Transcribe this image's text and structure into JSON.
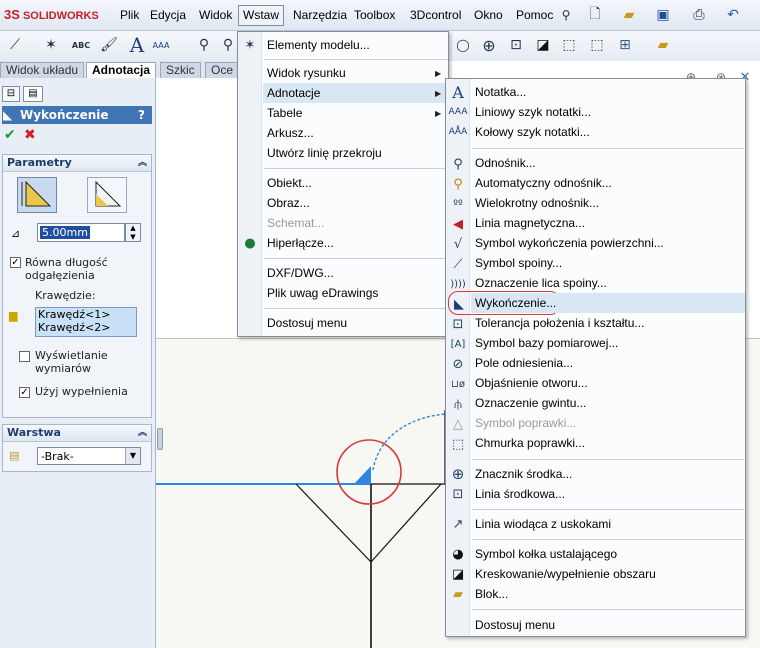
{
  "app": {
    "logo_symbol": "3S",
    "logo_text": "SOLIDWORKS"
  },
  "menubar": {
    "items": [
      "Plik",
      "Edycja",
      "Widok",
      "Wstaw",
      "Narzędzia",
      "Toolbox",
      "3Dcontrol",
      "Okno",
      "Pomoc"
    ]
  },
  "tabs": [
    "Widok układu",
    "Adnotacja",
    "Szkic",
    "Oce"
  ],
  "panel": {
    "title": "Wykończenie",
    "help": "?",
    "params_label": "Parametry",
    "value": "5.00mm",
    "equal_length_label": "Równa długość odgałęzienia",
    "edges_label": "Krawędzie:",
    "edges": [
      "Krawędź<1>",
      "Krawędź<2>"
    ],
    "show_dims_label": "Wyświetlanie wymiarów",
    "use_fill_label": "Użyj wypełnienia",
    "layer_label": "Warstwa",
    "layer_value": "-Brak-"
  },
  "wstaw_menu": {
    "items": [
      "Elementy modelu...",
      "Widok rysunku",
      "Adnotacje",
      "Tabele",
      "Arkusz...",
      "Utwórz linię przekroju",
      "Obiekt...",
      "Obraz...",
      "Schemat...",
      "Hiperłącze...",
      "DXF/DWG...",
      "Plik uwag eDrawings",
      "Dostosuj menu"
    ]
  },
  "adnotacje_menu": {
    "items": [
      "Notatka...",
      "Liniowy szyk notatki...",
      "Kołowy szyk notatki...",
      "Odnośnik...",
      "Automatyczny odnośnik...",
      "Wielokrotny odnośnik...",
      "Linia magnetyczna...",
      "Symbol wykończenia powierzchni...",
      "Symbol spoiny...",
      "Oznaczenie lica spoiny...",
      "Wykończenie...",
      "Tolerancja położenia i kształtu...",
      "Symbol bazy pomiarowej...",
      "Pole odniesienia...",
      "Objaśnienie otworu...",
      "Oznaczenie gwintu...",
      "Symbol poprawki...",
      "Chmurka poprawki...",
      "Znacznik środka...",
      "Linia środkowa...",
      "Linia wiodąca z uskokami",
      "Symbol kołka ustalającego",
      "Kreskowanie/wypełnienie obszaru",
      "Blok...",
      "Dostosuj menu"
    ]
  },
  "colors": {
    "accent": "#3f74b5",
    "highlight_circle": "#d83a3a",
    "sketch_blue": "#2f86e0"
  }
}
